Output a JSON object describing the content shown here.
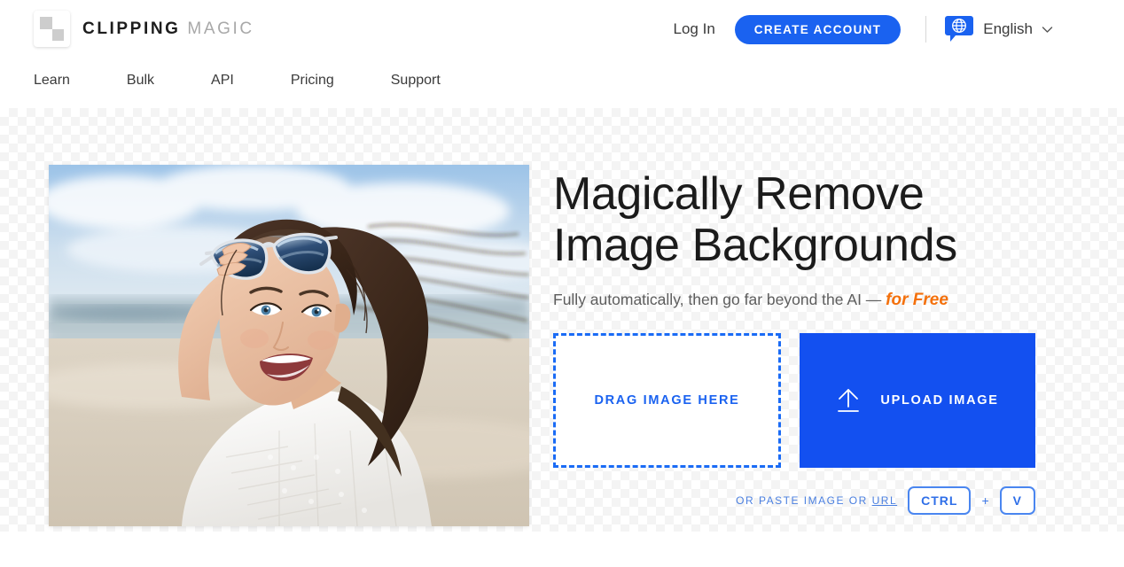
{
  "header": {
    "brand": {
      "word1": "CLIPPING",
      "word2": "MAGIC",
      "logo_icon": "checkerboard-logo-icon"
    },
    "login_label": "Log In",
    "create_account_label": "CREATE ACCOUNT",
    "language": {
      "label": "English",
      "icon": "globe-speech-bubble-icon",
      "chevron": "chevron-down-icon"
    },
    "accent_color": "#1a62f0"
  },
  "nav": {
    "items": [
      {
        "label": "Learn"
      },
      {
        "label": "Bulk"
      },
      {
        "label": "API"
      },
      {
        "label": "Pricing"
      },
      {
        "label": "Support"
      }
    ]
  },
  "hero": {
    "photo_alt": "Smiling woman on a beach lifting her sunglasses",
    "headline": "Magically Remove\nImage Backgrounds",
    "subhead_main": "Fully automatically, then go far beyond the AI — ",
    "subhead_highlight": "for Free",
    "highlight_color": "#f4700b",
    "dropzone_label": "DRAG IMAGE HERE",
    "upload_label": "UPLOAD IMAGE",
    "upload_icon": "upload-arrow-icon",
    "paste_prefix": "OR PASTE IMAGE OR ",
    "paste_url_link": "URL",
    "key_ctrl": "CTRL",
    "key_plus": "+",
    "key_v": "V"
  }
}
